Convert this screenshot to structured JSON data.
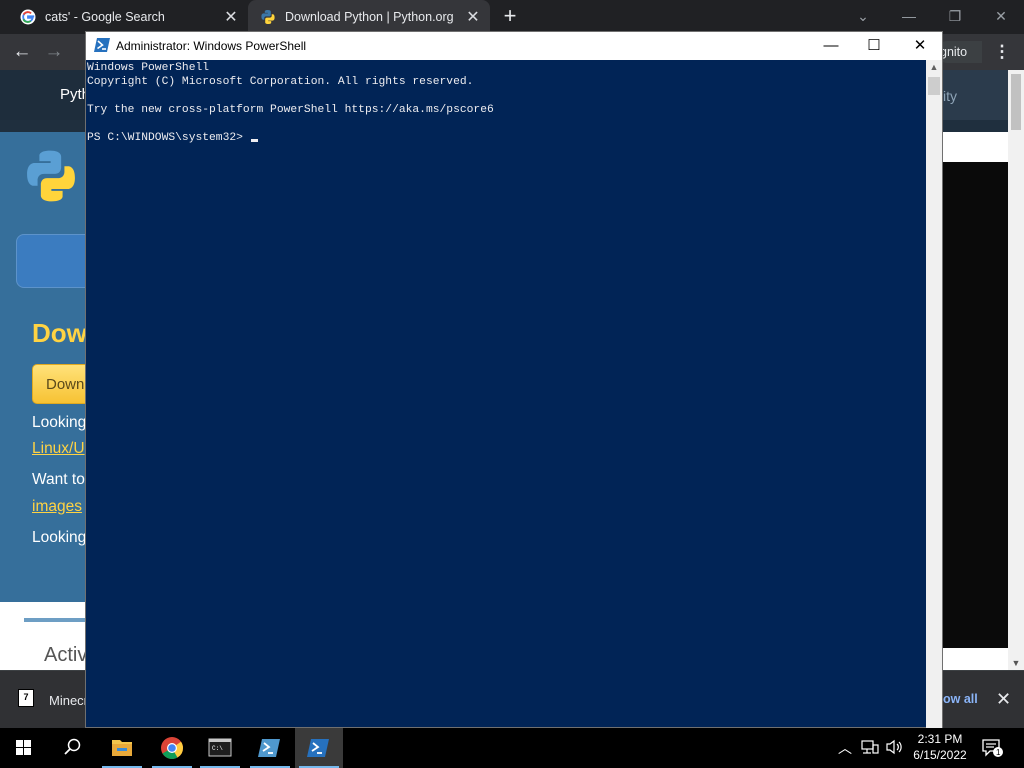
{
  "browser": {
    "tabs": [
      {
        "title": "cats' - Google Search",
        "icon": "google-icon"
      },
      {
        "title": "Download Python | Python.org",
        "icon": "python-icon"
      }
    ],
    "window_controls": {
      "tab_search": "⌄",
      "minimize": "—",
      "restore": "❐",
      "close": "✕"
    },
    "toolbar": {
      "back": "←",
      "forward": "→",
      "incognito_label": "gnito",
      "menu": "⋮"
    }
  },
  "python_site": {
    "nav_left": "Pyth",
    "nav_right": "ity",
    "heading": "Dow",
    "download_button": "Down",
    "lines": [
      {
        "text": "Looking"
      },
      {
        "link": "Linux/U"
      },
      {
        "text": "Want to"
      },
      {
        "link": "images"
      },
      {
        "text": "Looking"
      }
    ],
    "section_heading": "Activ"
  },
  "download_shelf": {
    "file_name": "Minecr",
    "show_all": "ow all",
    "close": "✕"
  },
  "powershell": {
    "title": "Administrator: Windows PowerShell",
    "controls": {
      "minimize": "—",
      "maximize": "☐",
      "close": "✕"
    },
    "console_lines": [
      "Windows PowerShell",
      "Copyright (C) Microsoft Corporation. All rights reserved.",
      "",
      "Try the new cross-platform PowerShell https://aka.ms/pscore6",
      "",
      "PS C:\\WINDOWS\\system32> "
    ],
    "colors": {
      "background": "#012456",
      "text": "#eeedf0"
    }
  },
  "taskbar": {
    "items": [
      "start-icon",
      "search-icon",
      "file-explorer-icon",
      "chrome-icon",
      "terminal-icon",
      "powershell-ise-icon",
      "powershell-icon"
    ],
    "time": "2:31 PM",
    "date": "6/15/2022",
    "notification_count": "1"
  }
}
